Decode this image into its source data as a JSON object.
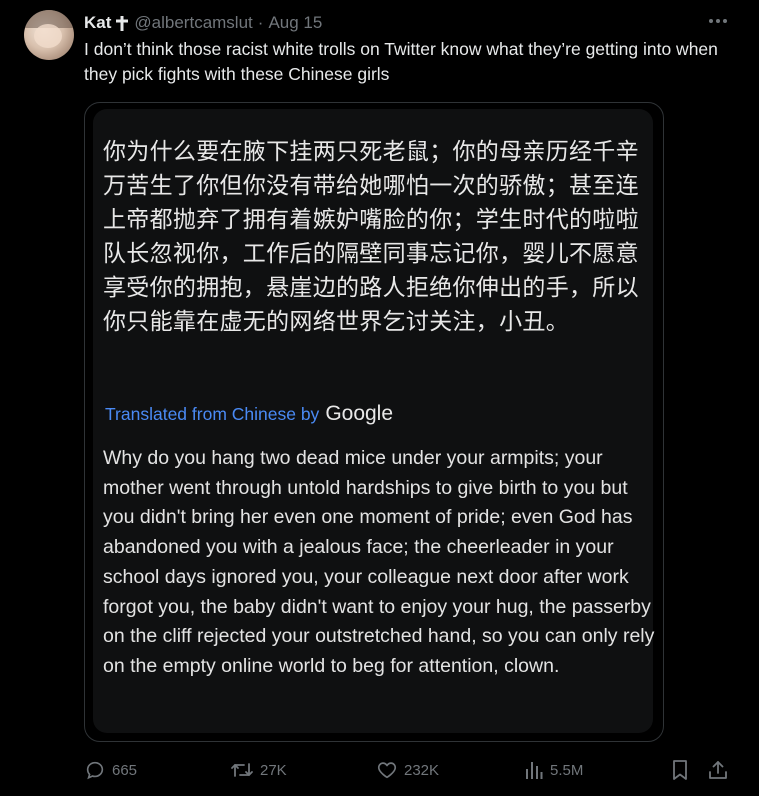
{
  "tweet": {
    "author_name": "Kat",
    "author_handle": "@albertcamslut",
    "separator": "·",
    "date": "Aug 15",
    "text": "I don’t think those racist white trolls on Twitter know what they’re getting into when they pick fights with these Chinese girls"
  },
  "media": {
    "chinese_text": "你为什么要在腋下挂两只死老鼠；你的母亲历经千辛万苦生了你但你没有带给她哪怕一次的骄傲；甚至连上帝都抛弃了拥有着嫉妒嘴脸的你；学生时代的啦啦队长忽视你，工作后的隔壁同事忘记你，婴儿不愿意享受你的拥抱，悬崖边的路人拒绝你伸出的手，所以你只能靠在虚无的网络世界乞讨关注，小丑。",
    "translated_label": "Translated from Chinese by",
    "translated_brand": "Google",
    "english_text": "Why do you hang two dead mice under your armpits; your mother went through untold hardships to give birth to you but you didn't bring her even one moment of pride; even God has abandoned you with a jealous face; the cheerleader in your school days ignored you, your colleague next door after work forgot you, the baby didn't want to enjoy your hug, the passerby on the cliff rejected your outstretched hand, so you can only rely on the empty online world to beg for attention, clown."
  },
  "actions": {
    "replies": "665",
    "reposts": "27K",
    "likes": "232K",
    "views": "5.5M"
  },
  "icons": {
    "verified_like": "latin-cross-icon",
    "more": "more-horizontal-icon",
    "reply": "reply-bubble-icon",
    "repost": "repost-icon",
    "like": "heart-icon",
    "views": "bar-chart-icon",
    "bookmark": "bookmark-icon",
    "share": "share-icon"
  },
  "colors": {
    "background": "#000000",
    "text_primary": "#e7e9ea",
    "text_secondary": "#71767b",
    "translated_link": "#4a8af4",
    "border": "#2f3336"
  }
}
